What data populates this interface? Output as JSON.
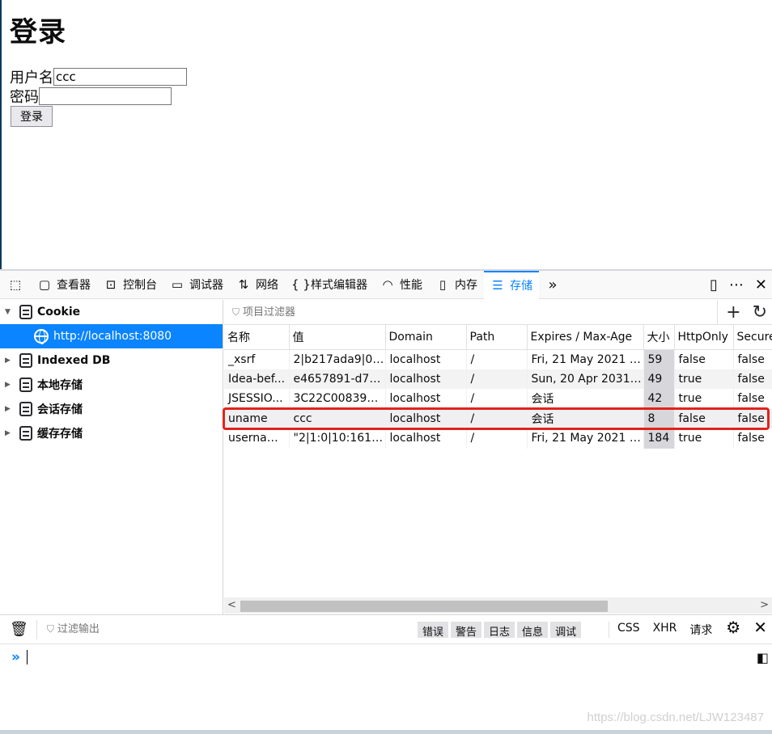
{
  "page": {
    "title": "登录",
    "username_label": "用户名",
    "username_value": "ccc",
    "password_label": "密码",
    "password_value": "",
    "login_button": "登录"
  },
  "toolbar": {
    "tabs": [
      {
        "label": "查看器",
        "icon": "inspector-icon"
      },
      {
        "label": "控制台",
        "icon": "console-icon"
      },
      {
        "label": "调试器",
        "icon": "debugger-icon"
      },
      {
        "label": "网络",
        "icon": "network-icon"
      },
      {
        "label": "样式编辑器",
        "icon": "style-editor-icon"
      },
      {
        "label": "性能",
        "icon": "performance-icon"
      },
      {
        "label": "内存",
        "icon": "memory-icon"
      },
      {
        "label": "存储",
        "icon": "storage-icon"
      }
    ],
    "active_tab": "存储",
    "accent": "#0a84ff"
  },
  "sidebar": {
    "cookie_label": "Cookie",
    "host": "http://localhost:8080",
    "items": [
      {
        "label": "Indexed DB"
      },
      {
        "label": "本地存储"
      },
      {
        "label": "会话存储"
      },
      {
        "label": "缓存存储"
      }
    ]
  },
  "table": {
    "filter_placeholder": "项目过滤器",
    "columns": [
      "名称",
      "值",
      "Domain",
      "Path",
      "Expires / Max-Age",
      "大小",
      "HttpOnly",
      "Secure"
    ],
    "rows": [
      {
        "name": "_xsrf",
        "value": "2|b217ada9|0e...",
        "domain": "localhost",
        "path": "/",
        "expires": "Fri, 21 May 2021 1...",
        "size": "59",
        "httponly": "false",
        "secure": "false"
      },
      {
        "name": "Idea-bef...",
        "value": "e4657891-d7c...",
        "domain": "localhost",
        "path": "/",
        "expires": "Sun, 20 Apr 2031 ...",
        "size": "49",
        "httponly": "true",
        "secure": "false"
      },
      {
        "name": "JSESSIO...",
        "value": "3C22C00839B...",
        "domain": "localhost",
        "path": "/",
        "expires": "会话",
        "size": "42",
        "httponly": "true",
        "secure": "false"
      },
      {
        "name": "uname",
        "value": "ccc",
        "domain": "localhost",
        "path": "/",
        "expires": "会话",
        "size": "8",
        "httponly": "false",
        "secure": "false"
      },
      {
        "name": "usernam...",
        "value": "\"2|1:0|10:1619...",
        "domain": "localhost",
        "path": "/",
        "expires": "Fri, 21 May 2021 1...",
        "size": "184",
        "httponly": "true",
        "secure": "false"
      }
    ],
    "highlight_color": "#e0241c"
  },
  "console": {
    "filter_placeholder": "过滤输出",
    "levels": [
      "错误",
      "警告",
      "日志",
      "信息",
      "调试"
    ],
    "net_filters": [
      "CSS",
      "XHR",
      "请求"
    ]
  },
  "watermark": "https://blog.csdn.net/LJW123487"
}
